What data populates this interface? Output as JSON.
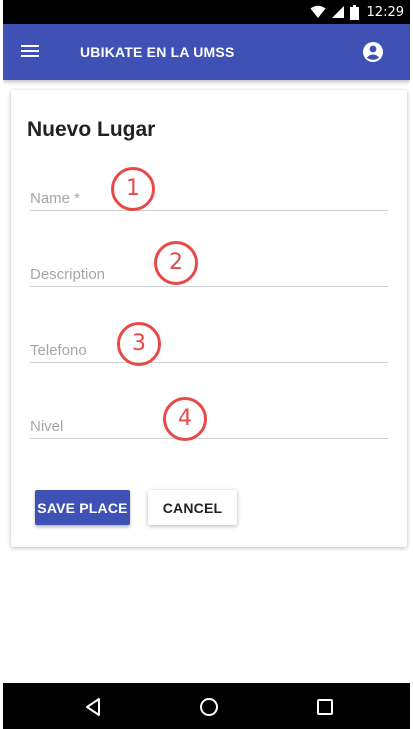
{
  "status_bar": {
    "time": "12:29",
    "icons": [
      "wifi-icon",
      "cell-signal-icon",
      "battery-icon"
    ]
  },
  "app_bar": {
    "title": "UBIKATE EN LA UMSS",
    "menu_icon": "menu-icon",
    "account_icon": "account-circle-icon",
    "color": "#3f51b5"
  },
  "form": {
    "title": "Nuevo Lugar",
    "fields": [
      {
        "placeholder": "Name *",
        "value": ""
      },
      {
        "placeholder": "Description",
        "value": ""
      },
      {
        "placeholder": "Telefono",
        "value": ""
      },
      {
        "placeholder": "Nivel",
        "value": ""
      }
    ],
    "markers": [
      "1",
      "2",
      "3",
      "4"
    ],
    "save_label": "SAVE PLACE",
    "cancel_label": "CANCEL",
    "marker_color": "#e84a4a"
  },
  "nav_bar": {
    "icons": [
      "back-icon",
      "home-icon",
      "recents-icon"
    ]
  }
}
